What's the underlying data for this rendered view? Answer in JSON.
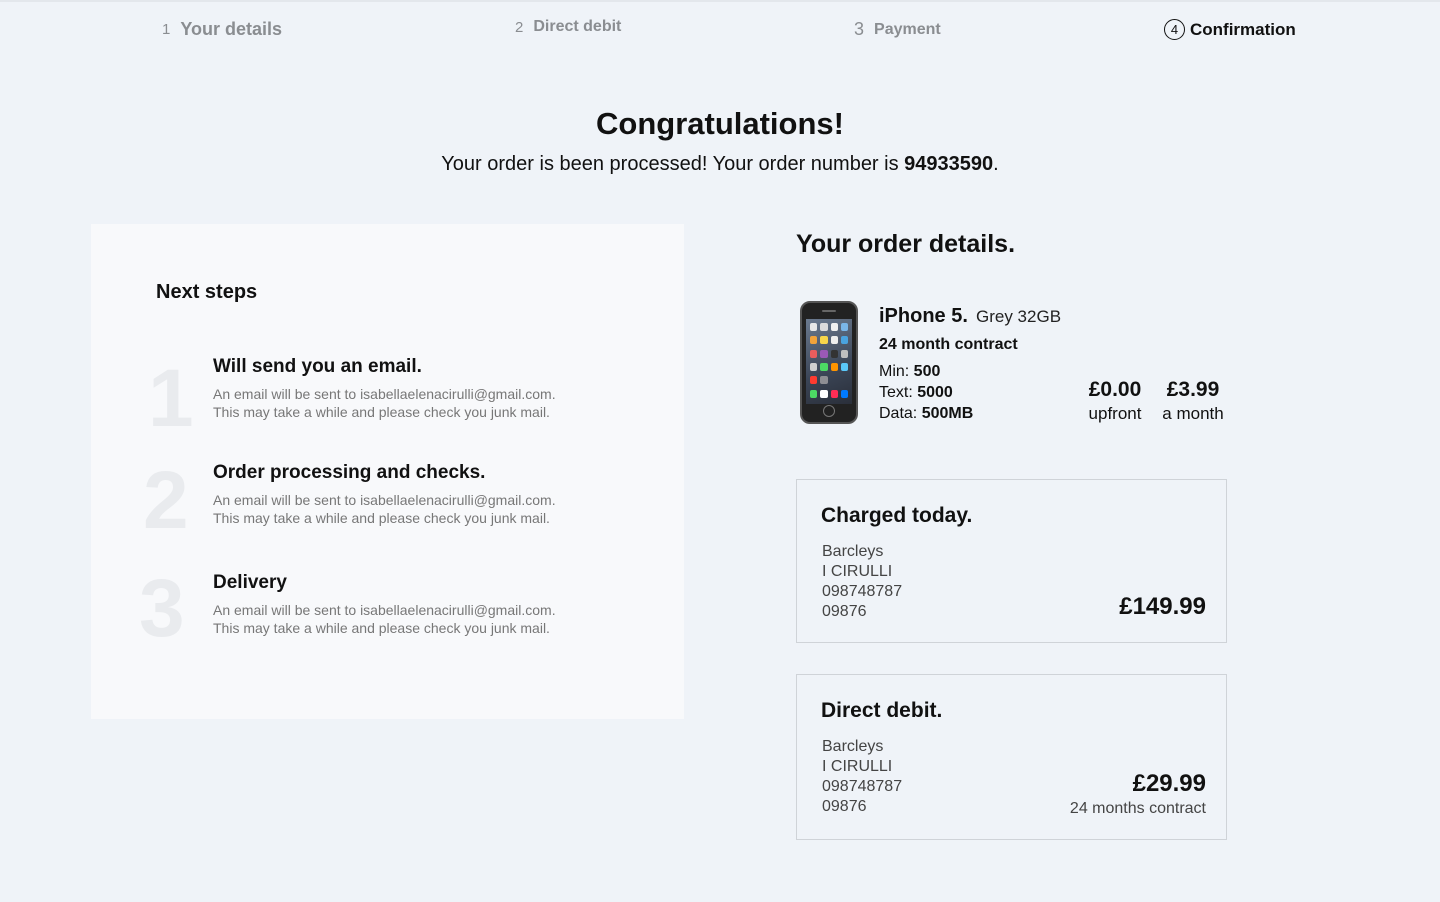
{
  "stepper": [
    {
      "num": "1",
      "label": "Your details",
      "state": "done"
    },
    {
      "num": "2",
      "label": "Direct debit",
      "state": "done"
    },
    {
      "num": "3",
      "label": "Payment",
      "state": "done"
    },
    {
      "num": "4",
      "label": "Confirmation",
      "state": "active"
    }
  ],
  "hero": {
    "title": "Congratulations!",
    "subtitle_prefix": "Your order is been processed! Your order number is ",
    "order_number": "94933590",
    "subtitle_suffix": "."
  },
  "next_steps": {
    "title": "Next steps",
    "items": [
      {
        "num": "1",
        "heading": "Will send you an email.",
        "line1": "An email will be sent to isabellaelenacirulli@gmail.com.",
        "line2": "This may take a while and please check you junk mail."
      },
      {
        "num": "2",
        "heading": "Order processing and checks.",
        "line1": "An email will be sent to isabellaelenacirulli@gmail.com.",
        "line2": "This may take a while and please check you junk mail."
      },
      {
        "num": "3",
        "heading": "Delivery",
        "line1": "An email will be sent to isabellaelenacirulli@gmail.com.",
        "line2": "This may take a while and please check you junk mail."
      }
    ]
  },
  "order": {
    "title": "Your order details.",
    "product_name": "iPhone 5.",
    "variant": "Grey 32GB",
    "contract": "24 month contract",
    "specs": {
      "min_label": "Min: ",
      "min_value": "500",
      "text_label": "Text: ",
      "text_value": "5000",
      "data_label": "Data: ",
      "data_value": "500MB"
    },
    "upfront_amount": "£0.00",
    "upfront_label": "upfront",
    "monthly_amount": "£3.99",
    "monthly_label": "a month"
  },
  "charged_today": {
    "title": "Charged today.",
    "bank": "Barcleys",
    "name": "I CIRULLI",
    "account": "098748787",
    "sort": "09876",
    "amount": "£149.99"
  },
  "direct_debit": {
    "title": "Direct debit.",
    "bank": "Barcleys",
    "name": "I CIRULLI",
    "account": "098748787",
    "sort": "09876",
    "amount": "£29.99",
    "note": "24 months contract"
  },
  "colors": {
    "background": "#eff3f8",
    "panel": "#f8f9fb",
    "text": "#111111",
    "muted": "#8a8d91"
  }
}
